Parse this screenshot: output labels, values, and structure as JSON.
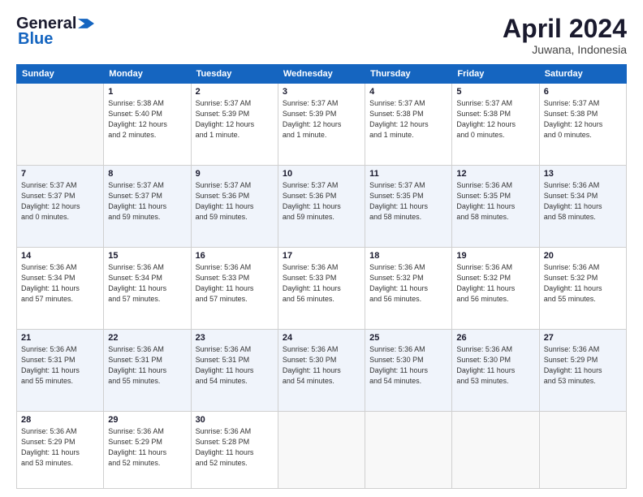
{
  "header": {
    "logo_line1": "General",
    "logo_line2": "Blue",
    "month": "April 2024",
    "location": "Juwana, Indonesia"
  },
  "weekdays": [
    "Sunday",
    "Monday",
    "Tuesday",
    "Wednesday",
    "Thursday",
    "Friday",
    "Saturday"
  ],
  "weeks": [
    [
      {
        "day": "",
        "info": ""
      },
      {
        "day": "1",
        "info": "Sunrise: 5:38 AM\nSunset: 5:40 PM\nDaylight: 12 hours\nand 2 minutes."
      },
      {
        "day": "2",
        "info": "Sunrise: 5:37 AM\nSunset: 5:39 PM\nDaylight: 12 hours\nand 1 minute."
      },
      {
        "day": "3",
        "info": "Sunrise: 5:37 AM\nSunset: 5:39 PM\nDaylight: 12 hours\nand 1 minute."
      },
      {
        "day": "4",
        "info": "Sunrise: 5:37 AM\nSunset: 5:38 PM\nDaylight: 12 hours\nand 1 minute."
      },
      {
        "day": "5",
        "info": "Sunrise: 5:37 AM\nSunset: 5:38 PM\nDaylight: 12 hours\nand 0 minutes."
      },
      {
        "day": "6",
        "info": "Sunrise: 5:37 AM\nSunset: 5:38 PM\nDaylight: 12 hours\nand 0 minutes."
      }
    ],
    [
      {
        "day": "7",
        "info": "Sunrise: 5:37 AM\nSunset: 5:37 PM\nDaylight: 12 hours\nand 0 minutes."
      },
      {
        "day": "8",
        "info": "Sunrise: 5:37 AM\nSunset: 5:37 PM\nDaylight: 11 hours\nand 59 minutes."
      },
      {
        "day": "9",
        "info": "Sunrise: 5:37 AM\nSunset: 5:36 PM\nDaylight: 11 hours\nand 59 minutes."
      },
      {
        "day": "10",
        "info": "Sunrise: 5:37 AM\nSunset: 5:36 PM\nDaylight: 11 hours\nand 59 minutes."
      },
      {
        "day": "11",
        "info": "Sunrise: 5:37 AM\nSunset: 5:35 PM\nDaylight: 11 hours\nand 58 minutes."
      },
      {
        "day": "12",
        "info": "Sunrise: 5:36 AM\nSunset: 5:35 PM\nDaylight: 11 hours\nand 58 minutes."
      },
      {
        "day": "13",
        "info": "Sunrise: 5:36 AM\nSunset: 5:34 PM\nDaylight: 11 hours\nand 58 minutes."
      }
    ],
    [
      {
        "day": "14",
        "info": "Sunrise: 5:36 AM\nSunset: 5:34 PM\nDaylight: 11 hours\nand 57 minutes."
      },
      {
        "day": "15",
        "info": "Sunrise: 5:36 AM\nSunset: 5:34 PM\nDaylight: 11 hours\nand 57 minutes."
      },
      {
        "day": "16",
        "info": "Sunrise: 5:36 AM\nSunset: 5:33 PM\nDaylight: 11 hours\nand 57 minutes."
      },
      {
        "day": "17",
        "info": "Sunrise: 5:36 AM\nSunset: 5:33 PM\nDaylight: 11 hours\nand 56 minutes."
      },
      {
        "day": "18",
        "info": "Sunrise: 5:36 AM\nSunset: 5:32 PM\nDaylight: 11 hours\nand 56 minutes."
      },
      {
        "day": "19",
        "info": "Sunrise: 5:36 AM\nSunset: 5:32 PM\nDaylight: 11 hours\nand 56 minutes."
      },
      {
        "day": "20",
        "info": "Sunrise: 5:36 AM\nSunset: 5:32 PM\nDaylight: 11 hours\nand 55 minutes."
      }
    ],
    [
      {
        "day": "21",
        "info": "Sunrise: 5:36 AM\nSunset: 5:31 PM\nDaylight: 11 hours\nand 55 minutes."
      },
      {
        "day": "22",
        "info": "Sunrise: 5:36 AM\nSunset: 5:31 PM\nDaylight: 11 hours\nand 55 minutes."
      },
      {
        "day": "23",
        "info": "Sunrise: 5:36 AM\nSunset: 5:31 PM\nDaylight: 11 hours\nand 54 minutes."
      },
      {
        "day": "24",
        "info": "Sunrise: 5:36 AM\nSunset: 5:30 PM\nDaylight: 11 hours\nand 54 minutes."
      },
      {
        "day": "25",
        "info": "Sunrise: 5:36 AM\nSunset: 5:30 PM\nDaylight: 11 hours\nand 54 minutes."
      },
      {
        "day": "26",
        "info": "Sunrise: 5:36 AM\nSunset: 5:30 PM\nDaylight: 11 hours\nand 53 minutes."
      },
      {
        "day": "27",
        "info": "Sunrise: 5:36 AM\nSunset: 5:29 PM\nDaylight: 11 hours\nand 53 minutes."
      }
    ],
    [
      {
        "day": "28",
        "info": "Sunrise: 5:36 AM\nSunset: 5:29 PM\nDaylight: 11 hours\nand 53 minutes."
      },
      {
        "day": "29",
        "info": "Sunrise: 5:36 AM\nSunset: 5:29 PM\nDaylight: 11 hours\nand 52 minutes."
      },
      {
        "day": "30",
        "info": "Sunrise: 5:36 AM\nSunset: 5:28 PM\nDaylight: 11 hours\nand 52 minutes."
      },
      {
        "day": "",
        "info": ""
      },
      {
        "day": "",
        "info": ""
      },
      {
        "day": "",
        "info": ""
      },
      {
        "day": "",
        "info": ""
      }
    ]
  ]
}
